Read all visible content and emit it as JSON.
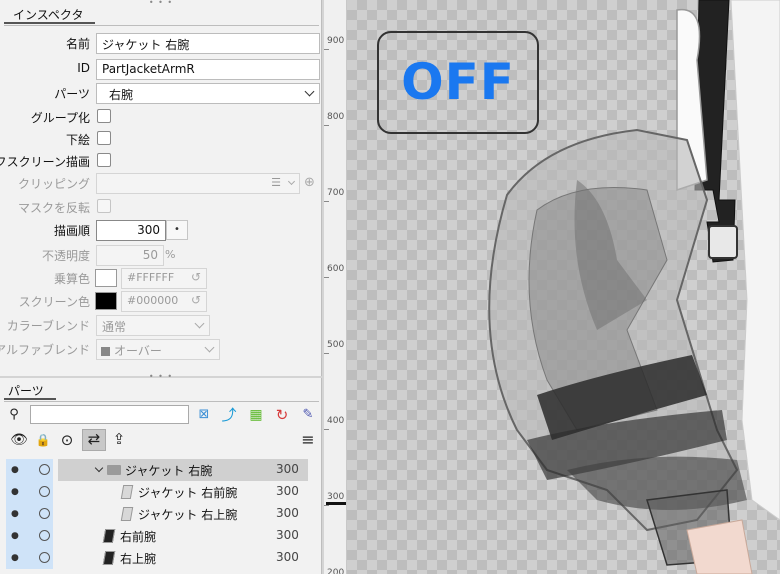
{
  "inspector": {
    "tab": "インスペクタ",
    "name_label": "名前",
    "name_value": "ジャケット 右腕",
    "id_label": "ID",
    "id_value": "PartJacketArmR",
    "parts_label": "パーツ",
    "parts_value": "右腕",
    "group_label": "グループ化",
    "underlay_label": "下絵",
    "offscreen_label": "オフスクリーン描画",
    "clipping_label": "クリッピング",
    "invert_mask_label": "マスクを反転",
    "draw_order_label": "描画順",
    "draw_order_value": "300",
    "draw_order_btn": "•",
    "opacity_label": "不透明度",
    "opacity_value": "50",
    "opacity_unit": "%",
    "multiply_label": "乗算色",
    "multiply_value": "#FFFFFF",
    "multiply_color": "#FFFFFF",
    "screen_label": "スクリーン色",
    "screen_value": "#000000",
    "screen_color": "#000000",
    "color_blend_label": "カラーブレンド",
    "color_blend_value": "通常",
    "alpha_blend_label": "アルファブレンド",
    "alpha_blend_value": "オーバー"
  },
  "parts_panel": {
    "tab": "パーツ",
    "tree": [
      {
        "name": "ジャケット 右腕",
        "value": "300",
        "type": "folder",
        "selected": true
      },
      {
        "name": "ジャケット 右前腕",
        "value": "300",
        "type": "art-light"
      },
      {
        "name": "ジャケット 右上腕",
        "value": "300",
        "type": "art-light"
      },
      {
        "name": "右前腕",
        "value": "300",
        "type": "art-dark"
      },
      {
        "name": "右上腕",
        "value": "300",
        "type": "art-dark"
      }
    ]
  },
  "ruler": {
    "ticks": [
      "900",
      "800",
      "700",
      "600",
      "500",
      "400",
      "300",
      "200"
    ]
  },
  "canvas": {
    "badge_text": "OFF",
    "badge_color": "#1a78f0"
  },
  "icons": [
    "eye-icon",
    "lock-icon",
    "chevron-circle-icon",
    "swap-icon",
    "export-icon",
    "menu-icon",
    "search-icon",
    "pin-icon"
  ]
}
